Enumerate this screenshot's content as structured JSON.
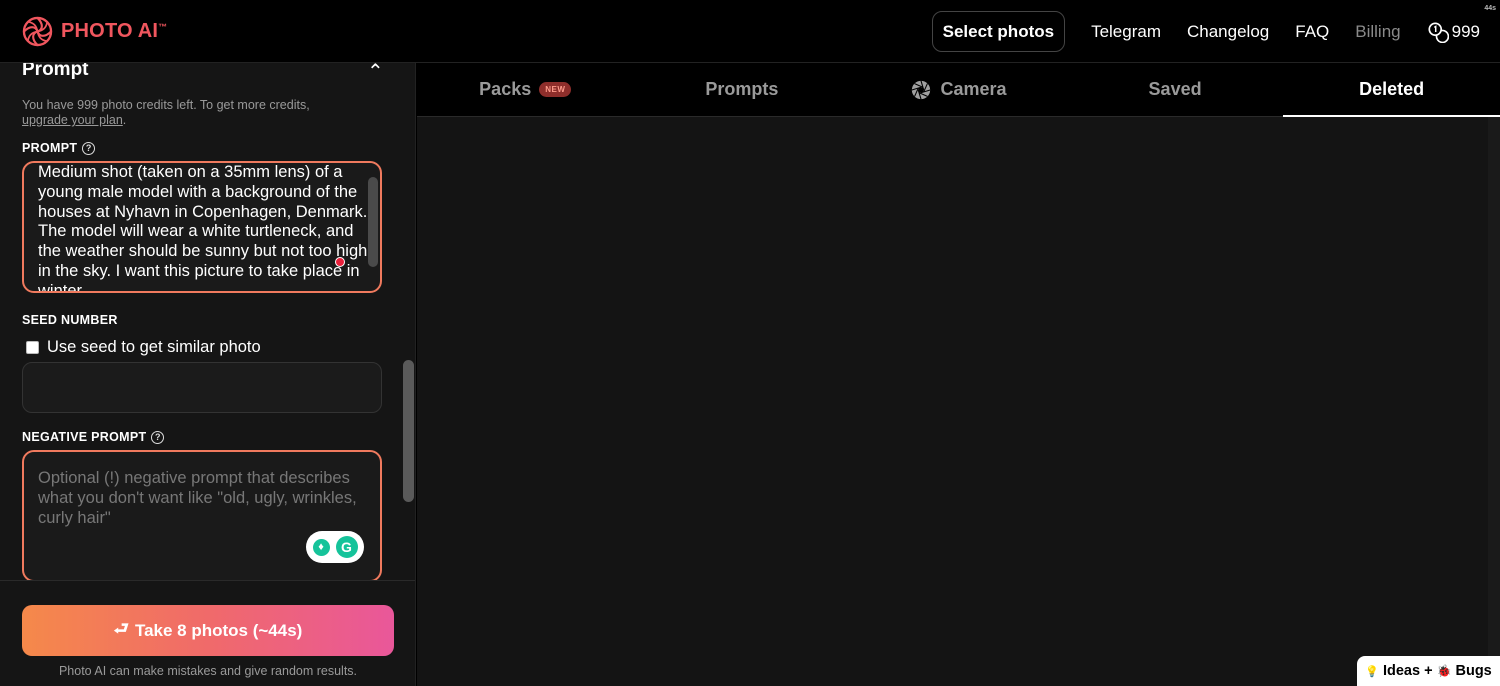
{
  "app": {
    "name": "PHOTO AI",
    "trademark": "™",
    "brand_color": "#f0565e"
  },
  "timer_badge": "44s",
  "nav": {
    "select_photos": "Select photos",
    "telegram": "Telegram",
    "changelog": "Changelog",
    "faq": "FAQ",
    "billing": "Billing",
    "credits": "999"
  },
  "panel": {
    "title": "Prompt",
    "credits_note_prefix": "You have 999 photo credits left. To get more credits,",
    "credits_note_link": "upgrade your plan",
    "credits_note_suffix": ".",
    "prompt_label": "PROMPT",
    "prompt_value": "Medium shot (taken on a 35mm lens) of a young male model with a background of the houses at Nyhavn in Copenhagen, Denmark. The model will wear a white turtleneck, and the weather should be sunny but not too high in the sky. I want this picture to take place in winter",
    "seed_label": "SEED NUMBER",
    "seed_checkbox": "Use seed to get similar photo",
    "seed_value": "",
    "negative_label": "NEGATIVE PROMPT",
    "negative_placeholder": "Optional (!) negative prompt that describes what you don't want like \"old, ugly, wrinkles, curly hair\"",
    "take_button": "Take 8 photos (~44s)",
    "disclaimer": "Photo AI can make mistakes and give random results."
  },
  "tabs": [
    {
      "label": "Packs",
      "badge": "NEW",
      "active": false
    },
    {
      "label": "Prompts",
      "active": false
    },
    {
      "label": "Camera",
      "icon": "aperture-icon",
      "active": false
    },
    {
      "label": "Saved",
      "active": false
    },
    {
      "label": "Deleted",
      "active": true
    }
  ],
  "feedback": {
    "ideas": "Ideas",
    "plus": "+",
    "bugs": "Bugs"
  }
}
